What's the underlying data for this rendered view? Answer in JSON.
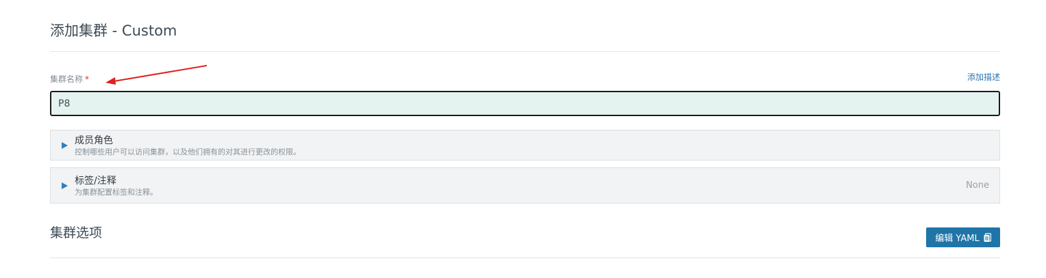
{
  "header": {
    "title": "添加集群 - Custom"
  },
  "cluster_name": {
    "label": "集群名称",
    "required_marker": "*",
    "value": "P8",
    "add_description_link": "添加描述"
  },
  "accordions": {
    "members": {
      "title": "成员角色",
      "description": "控制哪些用户可以访问集群，以及他们拥有的对其进行更改的权限。"
    },
    "labels": {
      "title": "标签/注释",
      "description": "为集群配置标签和注释。",
      "status": "None"
    }
  },
  "cluster_options": {
    "title": "集群选项",
    "edit_yaml_button": "编辑 YAML",
    "edit_yaml_icon": "clipboard-icon"
  },
  "annotation": {
    "arrow_color": "#e02020"
  },
  "colors": {
    "primary_button": "#1f75a8",
    "link": "#2a75b3",
    "input_background": "#e4f2f0",
    "caret": "#2f7fc1"
  }
}
